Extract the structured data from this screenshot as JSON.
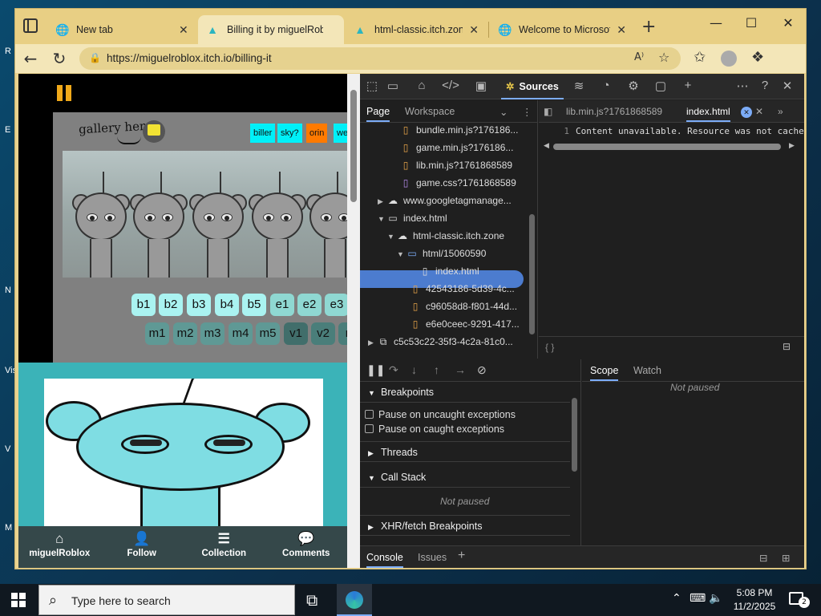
{
  "desktop": {
    "labels": [
      "R",
      "E",
      "N",
      "Vis",
      "V",
      "M"
    ]
  },
  "browser": {
    "tabs": [
      {
        "title": "New tab",
        "icon": "globe-icon"
      },
      {
        "title": "Billing it by miguelRoblox",
        "icon": "itch-icon"
      },
      {
        "title": "html-classic.itch.zone/h",
        "icon": "itch-icon"
      },
      {
        "title": "Welcome to Microsoft",
        "icon": "globe-icon"
      }
    ],
    "close_glyph": "✕",
    "new_tab_glyph": "+",
    "url": "https://miguelroblox.itch.io/billing-it",
    "read_aloud_glyph": "A⁾",
    "window": {
      "minimize": "—",
      "maximize": "☐",
      "close": "✕"
    }
  },
  "game": {
    "gallery_label": "gallery here",
    "top_buttons": [
      {
        "label": "biller",
        "color": "#00f0f8"
      },
      {
        "label": "sky?",
        "color": "#00f0f8"
      },
      {
        "label": "orin",
        "color": "#ff7a00"
      },
      {
        "label": "we",
        "color": "#00f0f8"
      }
    ],
    "beats_row1": [
      "b1",
      "b2",
      "b3",
      "b4",
      "b5",
      "e1",
      "e2",
      "e3"
    ],
    "beats_row2": [
      "m1",
      "m2",
      "m3",
      "m4",
      "m5",
      "v1",
      "v2",
      "m"
    ],
    "itch_bar": [
      {
        "label": "miguelRoblox",
        "icon": "store-icon"
      },
      {
        "label": "Follow",
        "icon": "add-user-icon"
      },
      {
        "label": "Collection",
        "icon": "add-list-icon"
      },
      {
        "label": "Comments",
        "icon": "comment-icon"
      }
    ]
  },
  "devtools": {
    "panel_name": "Sources",
    "subtabs": [
      "Page",
      "Workspace"
    ],
    "tree": [
      {
        "label": "bundle.min.js?176186...",
        "type": "js"
      },
      {
        "label": "game.min.js?176186...",
        "type": "js"
      },
      {
        "label": "lib.min.js?1761868589",
        "type": "js"
      },
      {
        "label": "game.css?1761868589",
        "type": "css"
      },
      {
        "label": "www.googletagmanage...",
        "type": "cloud"
      },
      {
        "label": "index.html",
        "type": "frame"
      },
      {
        "label": "html-classic.itch.zone",
        "type": "cloud"
      },
      {
        "label": "html/15060590",
        "type": "folder"
      },
      {
        "label": "index.html",
        "type": "file"
      },
      {
        "label": "42543186-5d39-4c...",
        "type": "js"
      },
      {
        "label": "c96058d8-f801-44d...",
        "type": "js"
      },
      {
        "label": "e6e0ceec-9291-417...",
        "type": "js"
      },
      {
        "label": "c5c53c22-35f3-4c2a-81c0...",
        "type": "ext"
      }
    ],
    "editor_tabs": [
      "lib.min.js?1761868589",
      "index.html"
    ],
    "code": {
      "line_no": "1",
      "text": "Content unavailable. Resource was not cache"
    },
    "pretty_print": "{ }",
    "debugger": {
      "sections": [
        "Breakpoints",
        "Threads",
        "Call Stack",
        "XHR/fetch Breakpoints"
      ],
      "checks": [
        "Pause on uncaught exceptions",
        "Pause on caught exceptions"
      ],
      "call_stack_status": "Not paused"
    },
    "scope_tabs": [
      "Scope",
      "Watch"
    ],
    "scope_status": "Not paused",
    "drawer_tabs": [
      "Console",
      "Issues"
    ]
  },
  "taskbar": {
    "search_placeholder": "Type here to search",
    "time": "5:08 PM",
    "date": "11/2/2025",
    "notification_count": "2"
  }
}
